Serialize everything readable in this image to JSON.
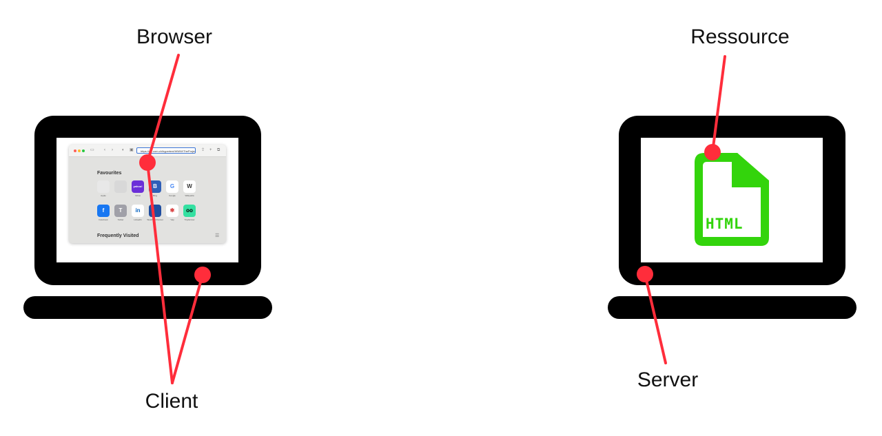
{
  "labels": {
    "browser": "Browser",
    "client": "Client",
    "ressource": "Ressource",
    "server": "Server"
  },
  "colors": {
    "device": "#000000",
    "screen": "#ffffff",
    "pointer": "#ff2d3b",
    "html_file": "#33d40c"
  },
  "browser_window": {
    "url": "https://w...com.ch/hypertext/WWW/TheProject.html",
    "favourites_title": "Favourites",
    "frequently_visited_title": "Frequently Visited",
    "favourites": [
      {
        "name": "Apple",
        "glyph": "",
        "bg": "#e8e8e8",
        "fg": "#555"
      },
      {
        "name": "",
        "glyph": "",
        "bg": "#d8d8d8",
        "fg": "#777"
      },
      {
        "name": "Yahoo",
        "glyph": "yahoo!",
        "bg": "#6b2fd8",
        "fg": "#ffffff"
      },
      {
        "name": "Bing",
        "glyph": "B",
        "bg": "#2f5fb8",
        "fg": "#ffffff"
      },
      {
        "name": "Google",
        "glyph": "G",
        "bg": "#ffffff",
        "fg": "#4285f4"
      },
      {
        "name": "Wikipedia",
        "glyph": "W",
        "bg": "#ffffff",
        "fg": "#333333"
      },
      {
        "name": "Facebook",
        "glyph": "f",
        "bg": "#1877f2",
        "fg": "#ffffff"
      },
      {
        "name": "Twitter",
        "glyph": "T",
        "bg": "#a0a0a8",
        "fg": "#ffffff"
      },
      {
        "name": "LinkedIn",
        "glyph": "in",
        "bg": "#ffffff",
        "fg": "#0a66c2"
      },
      {
        "name": "Weather Channel",
        "glyph": "",
        "bg": "#1f4ea0",
        "fg": "#ffffff"
      },
      {
        "name": "Yelp",
        "glyph": "✻",
        "bg": "#ffffff",
        "fg": "#d32323"
      },
      {
        "name": "TripAdvisor",
        "glyph": "oo",
        "bg": "#34e0a1",
        "fg": "#000000"
      }
    ]
  },
  "html_file": {
    "text": "HTML",
    "icon": "html-file-icon"
  }
}
